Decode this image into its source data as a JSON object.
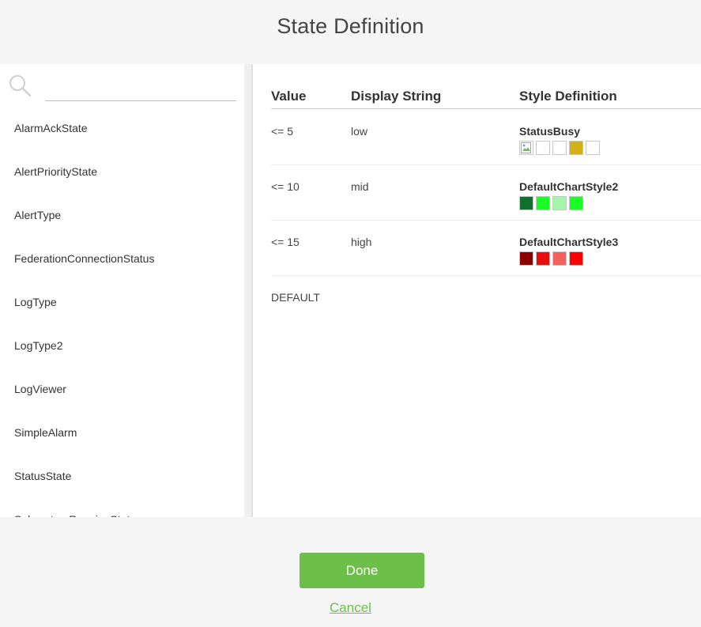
{
  "dialog": {
    "title": "State Definition"
  },
  "search": {
    "placeholder": "",
    "value": "",
    "icon": "search-icon"
  },
  "sidebar": {
    "items": [
      {
        "label": "AlarmAckState"
      },
      {
        "label": "AlertPriorityState"
      },
      {
        "label": "AlertType"
      },
      {
        "label": "FederationConnectionStatus"
      },
      {
        "label": "LogType"
      },
      {
        "label": "LogType2"
      },
      {
        "label": "LogViewer"
      },
      {
        "label": "SimpleAlarm"
      },
      {
        "label": "StatusState"
      },
      {
        "label": "SubsystemRunningState"
      }
    ]
  },
  "table": {
    "headers": {
      "value": "Value",
      "display": "Display String",
      "style": "Style Definition"
    },
    "rows": [
      {
        "value": "<= 5",
        "display": "low",
        "style_name": "StatusBusy",
        "swatches": [
          "broken-image",
          "#ffffff",
          "#ffffff",
          "#d4b017",
          "#ffffff"
        ]
      },
      {
        "value": "<= 10",
        "display": "mid",
        "style_name": "DefaultChartStyle2",
        "swatches": [
          "#0f7030",
          "#19ff26",
          "#a4f7a8",
          "#19ff26"
        ]
      },
      {
        "value": "<= 15",
        "display": "high",
        "style_name": "DefaultChartStyle3",
        "swatches": [
          "#8c0000",
          "#e50f0f",
          "#f26060",
          "#ff0000"
        ]
      }
    ],
    "default_label": "DEFAULT"
  },
  "footer": {
    "done_label": "Done",
    "cancel_label": "Cancel"
  },
  "colors": {
    "accent": "#6cc04a"
  }
}
